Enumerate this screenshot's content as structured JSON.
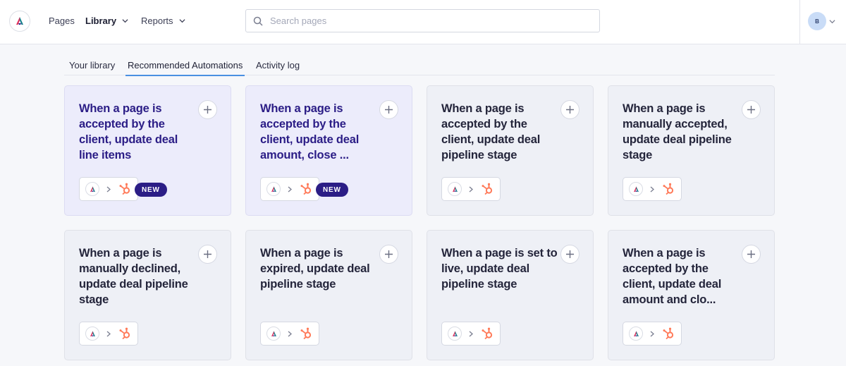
{
  "nav": {
    "pages": "Pages",
    "library": "Library",
    "reports": "Reports"
  },
  "search": {
    "placeholder": "Search pages"
  },
  "user": {
    "initial": "B"
  },
  "tabs": [
    {
      "label": "Your library"
    },
    {
      "label": "Recommended Automations"
    },
    {
      "label": "Activity log"
    }
  ],
  "cards": [
    {
      "title": "When a page is accepted by the client, update deal line items",
      "badge": "NEW"
    },
    {
      "title": "When a page is accepted by the client, update deal amount, close ...",
      "badge": "NEW"
    },
    {
      "title": "When a page is accepted by the client, update deal pipeline stage"
    },
    {
      "title": "When a page is manually accepted, update deal pipeline stage"
    },
    {
      "title": "When a page is manually declined, update deal pipeline stage"
    },
    {
      "title": "When a page is expired, update deal pipeline stage"
    },
    {
      "title": "When a page is set to live, update deal pipeline stage"
    },
    {
      "title": "When a page is accepted by the client, update deal amount and clo..."
    }
  ],
  "icons": {
    "add": "plus-icon",
    "source": "app-logo-icon",
    "target": "hubspot-icon",
    "separator": "chevron-right-icon"
  },
  "colors": {
    "accent_tab": "#4a90e2",
    "badge": "#2b1d86",
    "hubspot": "#ff7a59",
    "highlight_card": "#ececfb"
  }
}
